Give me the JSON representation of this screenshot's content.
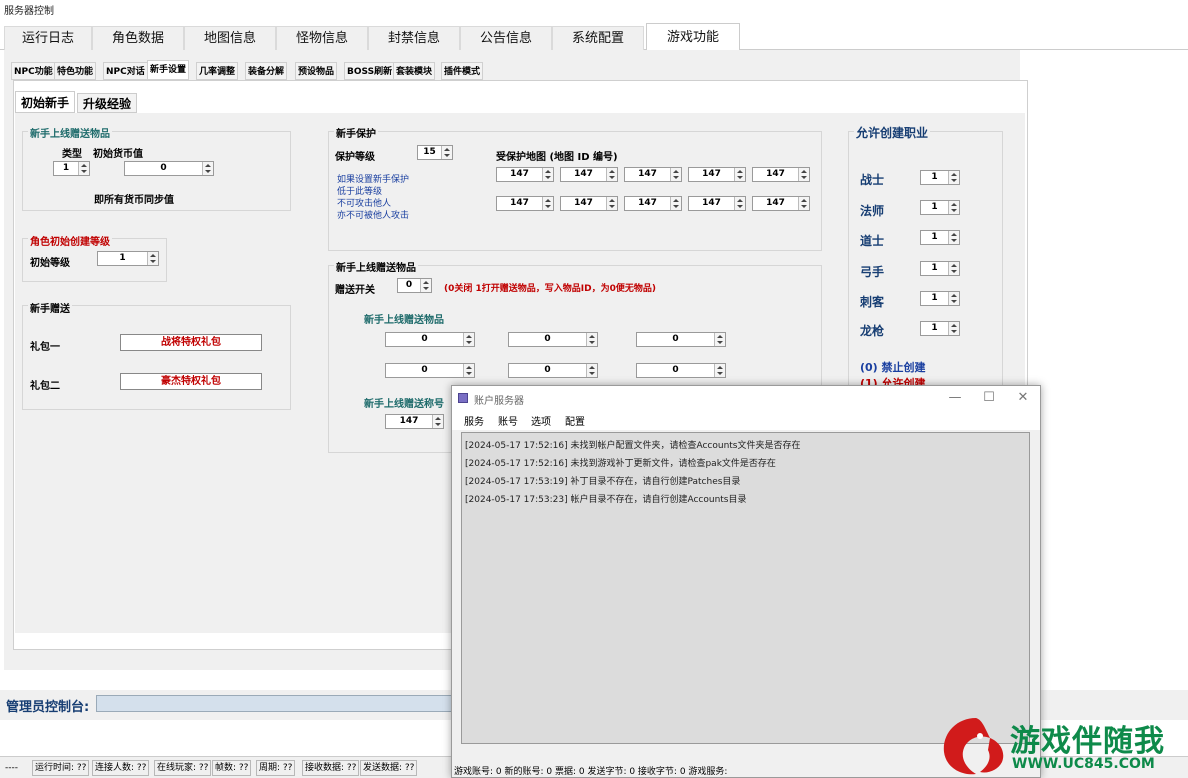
{
  "window": {
    "title": "服务器控制"
  },
  "main_tabs": [
    "运行日志",
    "角色数据",
    "地图信息",
    "怪物信息",
    "封禁信息",
    "公告信息",
    "系统配置",
    "游戏功能"
  ],
  "sub_tabs": [
    "NPC功能",
    "特色功能",
    "NPC对话",
    "新手设置",
    "几率调整",
    "装备分解",
    "预设物品",
    "BOSS刷新",
    "套装模块",
    "插件模式"
  ],
  "page_tabs": [
    "初始新手",
    "升级经验"
  ],
  "gift_items": {
    "title": "新手上线赠送物品",
    "type_label": "类型",
    "currency_label": "初始货币值",
    "type_value": "1",
    "currency_value": "0",
    "note": "即所有货币同步值"
  },
  "role_level": {
    "title": "角色初始创建等级",
    "label": "初始等级",
    "value": "1"
  },
  "newbie_gift": {
    "title": "新手赠送",
    "pack1_label": "礼包一",
    "pack1_value": "战将特权礼包",
    "pack2_label": "礼包二",
    "pack2_value": "豪杰特权礼包"
  },
  "protect": {
    "title": "新手保护",
    "level_label": "保护等级",
    "level_value": "15",
    "map_label": "受保护地图 (地图 ID 编号)",
    "desc": [
      "如果设置新手保护",
      "低于此等级",
      "不可攻击他人",
      "亦不可被他人攻击"
    ],
    "row1": [
      "147",
      "147",
      "147",
      "147",
      "147"
    ],
    "row2": [
      "147",
      "147",
      "147",
      "147",
      "147"
    ]
  },
  "online_gift": {
    "title": "新手上线赠送物品",
    "switch_label": "赠送开关",
    "switch_value": "0",
    "switch_hint": "(0关闭 1打开赠送物品，写入物品ID，为0便无物品)",
    "items_label": "新手上线赠送物品",
    "row1": [
      "0",
      "0",
      "0"
    ],
    "row2": [
      "0",
      "0",
      "0"
    ],
    "title_label": "新手上线赠送称号",
    "title_value": "147"
  },
  "classes": {
    "title": "允许创建职业",
    "items": [
      {
        "name": "战士",
        "value": "1"
      },
      {
        "name": "法师",
        "value": "1"
      },
      {
        "name": "道士",
        "value": "1"
      },
      {
        "name": "弓手",
        "value": "1"
      },
      {
        "name": "刺客",
        "value": "1"
      },
      {
        "name": "龙枪",
        "value": "1"
      }
    ],
    "legend0": "(0) 禁止创建",
    "legend1": "(1) 允许创建"
  },
  "console": {
    "label": "管理员控制台:"
  },
  "statusbar": [
    "----",
    "运行时间: ??",
    "连接人数: ??",
    "在线玩家: ??",
    "帧数: ??",
    "周期: ??",
    "接收数据: ??",
    "发送数据: ??"
  ],
  "dialog": {
    "title": "账户服务器",
    "menu": [
      "服务",
      "账号",
      "选项",
      "配置"
    ],
    "logs": [
      "[2024-05-17 17:52:16] 未找到帐户配置文件夹，请检查Accounts文件夹是否存在",
      "[2024-05-17 17:52:16] 未找到游戏补丁更新文件，请检查pak文件是否存在",
      "[2024-05-17 17:53:19] 补丁目录不存在，请自行创建Patches目录",
      "[2024-05-17 17:53:23] 帐户目录不存在，请自行创建Accounts目录"
    ],
    "status": "游戏账号: 0  新的账号: 0  票据: 0  发送字节: 0  接收字节: 0  游戏服务:"
  },
  "watermark": {
    "text": "游戏伴随我",
    "url": "WWW.UC845.COM"
  }
}
